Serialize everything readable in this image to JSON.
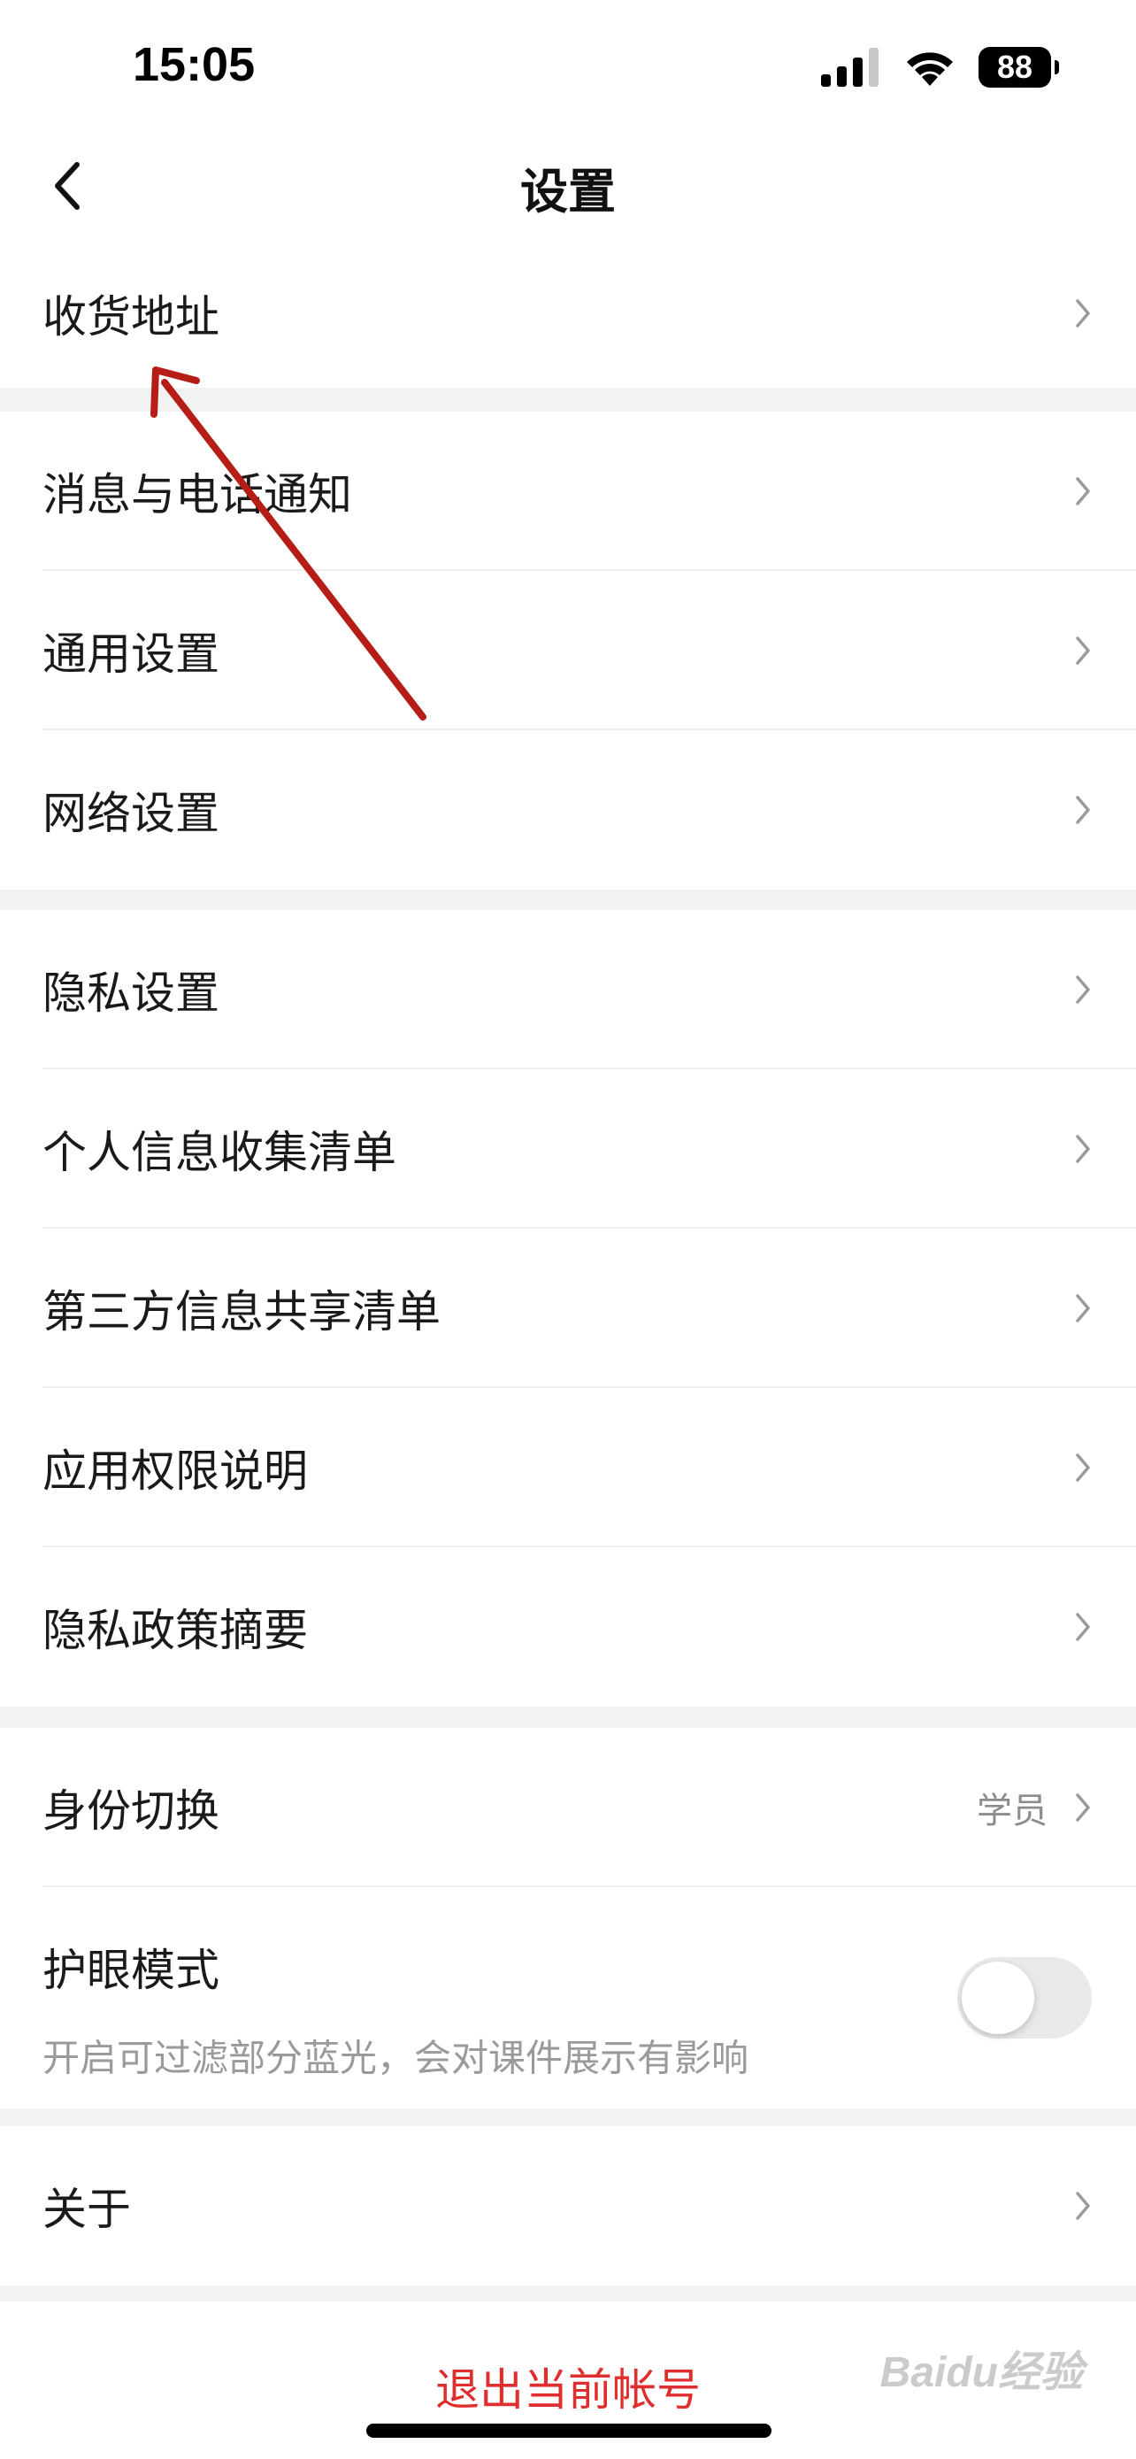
{
  "status_bar": {
    "time": "15:05",
    "battery": "88"
  },
  "header": {
    "title": "设置"
  },
  "groups": [
    {
      "items": [
        {
          "label": "收货地址"
        }
      ]
    },
    {
      "items": [
        {
          "label": "消息与电话通知"
        },
        {
          "label": "通用设置"
        },
        {
          "label": "网络设置"
        }
      ]
    },
    {
      "items": [
        {
          "label": "隐私设置"
        },
        {
          "label": "个人信息收集清单"
        },
        {
          "label": "第三方信息共享清单"
        },
        {
          "label": "应用权限说明"
        },
        {
          "label": "隐私政策摘要"
        }
      ]
    },
    {
      "items": [
        {
          "label": "身份切换",
          "value": "学员"
        },
        {
          "label": "护眼模式",
          "sublabel": "开启可过滤部分蓝光，会对课件展示有影响",
          "toggle": false
        }
      ]
    },
    {
      "items": [
        {
          "label": "关于"
        }
      ]
    }
  ],
  "logout_label": "退出当前帐号",
  "watermark": "Baidu经验",
  "colors": {
    "accent_red": "#e02e2e",
    "annotation_arrow": "#b51d16"
  }
}
